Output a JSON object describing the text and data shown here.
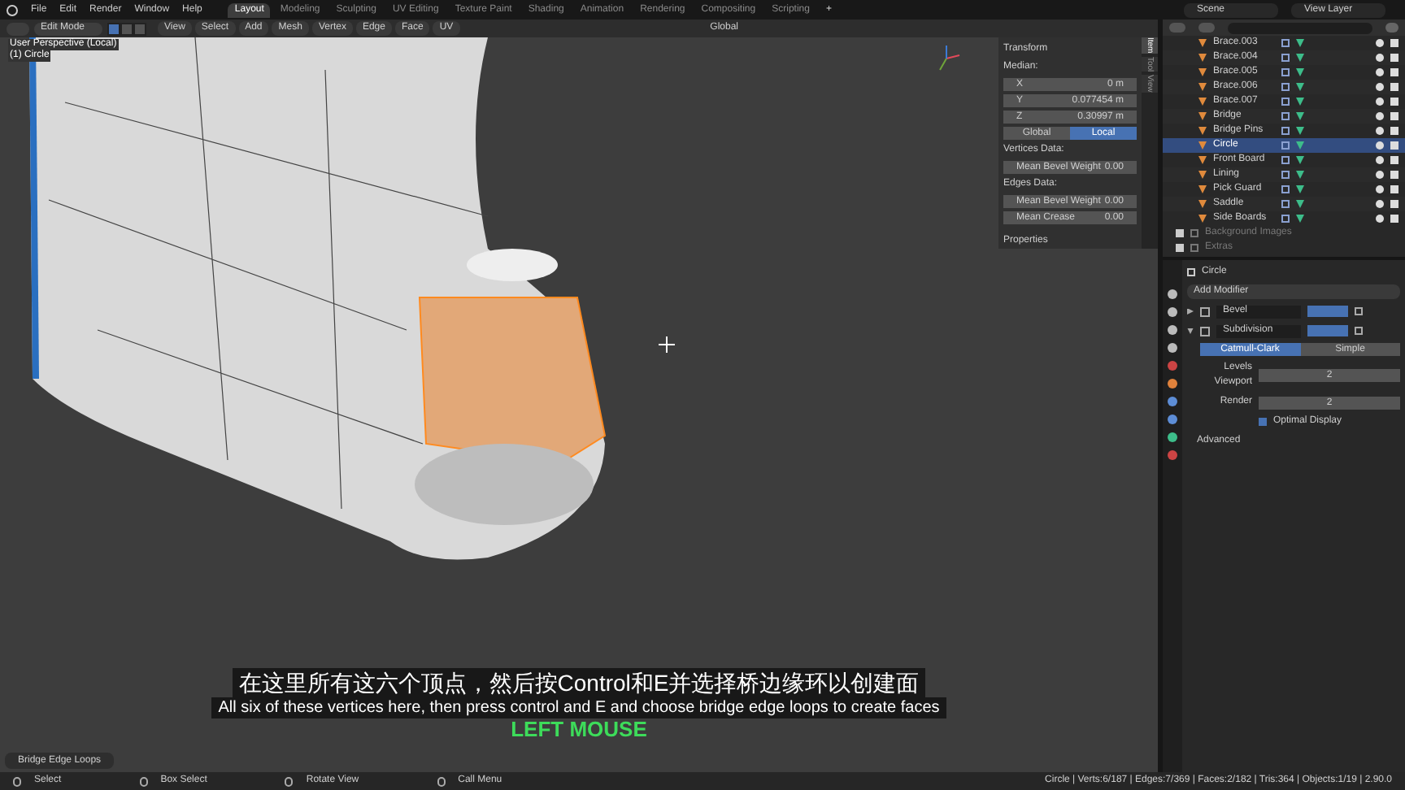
{
  "menu": [
    "File",
    "Edit",
    "Render",
    "Window",
    "Help"
  ],
  "workspaces": [
    {
      "label": "Layout",
      "selected": true
    },
    {
      "label": "Modeling",
      "selected": false
    },
    {
      "label": "Sculpting",
      "selected": false
    },
    {
      "label": "UV Editing",
      "selected": false
    },
    {
      "label": "Texture Paint",
      "selected": false
    },
    {
      "label": "Shading",
      "selected": false
    },
    {
      "label": "Animation",
      "selected": false
    },
    {
      "label": "Rendering",
      "selected": false
    },
    {
      "label": "Compositing",
      "selected": false
    },
    {
      "label": "Scripting",
      "selected": false
    }
  ],
  "add_workspace": "+",
  "scene": "Scene",
  "view_layer": "View Layer",
  "viewport_header": {
    "mode": "Edit Mode",
    "select_modes": [
      {
        "selected": true
      },
      {
        "selected": false
      },
      {
        "selected": false
      }
    ],
    "menus": [
      "View",
      "Select",
      "Add",
      "Mesh",
      "Vertex",
      "Edge",
      "Face",
      "UV"
    ],
    "orientation": "Global"
  },
  "viewport": {
    "view_name": "User Perspective (Local)",
    "object_name": "(1) Circle",
    "subtitle_zh": "在这里所有这六个顶点，然后按Control和E并选择桥边缘环以创建面",
    "subtitle_en": "All six of these vertices here, then press control and E and choose bridge edge loops to create faces",
    "key_overlay": "LEFT MOUSE"
  },
  "n_panel": {
    "tabs": [
      {
        "label": "Item",
        "selected": true
      },
      {
        "label": "Tool",
        "selected": false
      },
      {
        "label": "View",
        "selected": false
      }
    ],
    "transform": "Transform",
    "median": "Median:",
    "coords": [
      {
        "label": "X",
        "value": "0 m"
      },
      {
        "label": "Y",
        "value": "0.077454 m"
      },
      {
        "label": "Z",
        "value": "0.30997 m"
      }
    ],
    "spaces": [
      {
        "label": "Global",
        "selected": false
      },
      {
        "label": "Local",
        "selected": true
      }
    ],
    "groups": [
      {
        "title": "Vertices Data:",
        "fields": [
          {
            "label": "Mean Bevel Weight",
            "value": "0.00"
          }
        ]
      },
      {
        "title": "Edges Data:",
        "fields": [
          {
            "label": "Mean Bevel Weight",
            "value": "0.00"
          },
          {
            "label": "Mean Crease",
            "value": "0.00"
          }
        ]
      }
    ],
    "properties": "Properties"
  },
  "outliner": {
    "items": [
      {
        "name": "Brace.003",
        "selected": false
      },
      {
        "name": "Brace.004",
        "selected": false
      },
      {
        "name": "Brace.005",
        "selected": false
      },
      {
        "name": "Brace.006",
        "selected": false
      },
      {
        "name": "Brace.007",
        "selected": false
      },
      {
        "name": "Bridge",
        "selected": false
      },
      {
        "name": "Bridge Pins",
        "selected": false
      },
      {
        "name": "Circle",
        "selected": true
      },
      {
        "name": "Front Board",
        "selected": false
      },
      {
        "name": "Lining",
        "selected": false
      },
      {
        "name": "Pick Guard",
        "selected": false
      },
      {
        "name": "Saddle",
        "selected": false
      },
      {
        "name": "Side Boards",
        "selected": false
      }
    ],
    "collections": [
      {
        "name": "Background Images",
        "checked": true
      },
      {
        "name": "Extras",
        "checked": true
      }
    ]
  },
  "properties": {
    "object": "Circle",
    "add_modifier": "Add Modifier",
    "modifiers": [
      {
        "name": "Bevel",
        "expanded": false
      },
      {
        "name": "Subdivision",
        "expanded": true
      }
    ],
    "algorithms": [
      {
        "label": "Catmull-Clark",
        "selected": true
      },
      {
        "label": "Simple",
        "selected": false
      }
    ],
    "levels": [
      {
        "label": "Levels Viewport",
        "value": "2"
      },
      {
        "label": "Render",
        "value": "2"
      }
    ],
    "optimal_display": {
      "label": "Optimal Display",
      "checked": true
    },
    "advanced": "Advanced"
  },
  "operator_panel": "Bridge Edge Loops",
  "status_bar": {
    "hints": [
      "Select",
      "Box Select",
      "Rotate View",
      "Call Menu"
    ],
    "stats": "Circle | Verts:6/187 | Edges:7/369 | Faces:2/182 | Tris:364 | Objects:1/19 | 2.90.0"
  }
}
